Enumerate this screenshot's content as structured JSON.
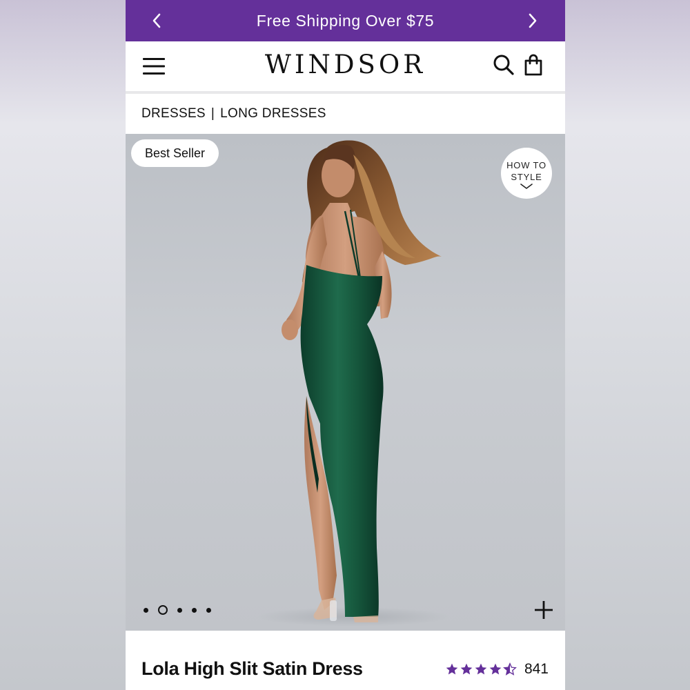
{
  "promo_bar": {
    "text": "Free Shipping Over $75",
    "prev_icon": "chevron-left-icon",
    "next_icon": "chevron-right-icon",
    "background": "#64309a"
  },
  "header": {
    "logo": "WINDSOR",
    "menu_icon": "hamburger-icon",
    "search_icon": "search-icon",
    "bag_icon": "shopping-bag-icon"
  },
  "breadcrumb": {
    "items": [
      "DRESSES",
      "LONG DRESSES"
    ],
    "separator": "|"
  },
  "gallery": {
    "badge": "Best Seller",
    "how_to_style": {
      "line1": "HOW TO",
      "line2": "STYLE"
    },
    "image_count": 5,
    "active_image": 2,
    "expand_icon": "plus-icon"
  },
  "product": {
    "name": "Lola High Slit Satin Dress",
    "rating": 4.5,
    "review_count": "841",
    "star_color": "#64309a"
  }
}
